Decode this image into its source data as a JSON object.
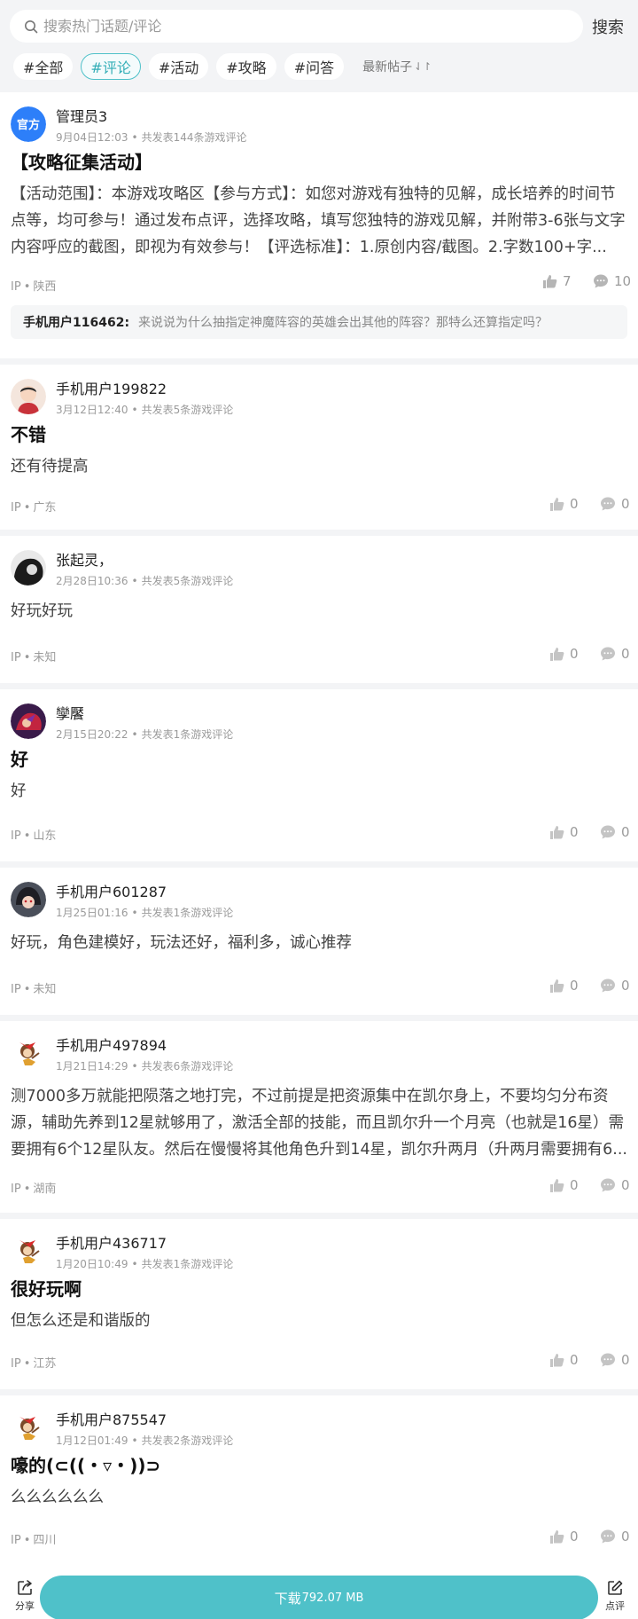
{
  "search": {
    "placeholder": "搜索热门话题/评论",
    "button": "搜索"
  },
  "filters": {
    "chips": [
      "#全部",
      "#评论",
      "#活动",
      "#攻略",
      "#问答"
    ],
    "active_index": 1,
    "sort_label": "最新帖子",
    "sort_icon": "sort-arrows-icon"
  },
  "colors": {
    "accent": "#4fc1c9",
    "official": "#2d7ff9"
  },
  "posts": [
    {
      "author": "管理员3",
      "avatar_badge": "官方",
      "time": "9月04日12:03",
      "count_text": "共发表144条游戏评论",
      "title": "【攻略征集活动】",
      "body": "【活动范围】：本游戏攻略区【参与方式】：如您对游戏有独特的见解，成长培养的时间节点等，均可参与！通过发布点评，选择攻略，填写您独特的游戏见解，并附带3-6张与文字内容呼应的截图，即视为有效参与！【评选标准】：1.原创内容/截图。2.字数100+字...",
      "ip_label": "IP",
      "ip": "陕西",
      "likes": "7",
      "comments": "10",
      "reply_user": "手机用户116462:",
      "reply_text": "来说说为什么抽指定神魔阵容的英雄会出其他的阵容？那特么还算指定吗？"
    },
    {
      "author": "手机用户199822",
      "time": "3月12日12:40",
      "count_text": "共发表5条游戏评论",
      "title": "不错",
      "body": "还有待提高",
      "ip_label": "IP",
      "ip": "广东",
      "likes": "0",
      "comments": "0"
    },
    {
      "author": "张起灵，",
      "time": "2月28日10:36",
      "count_text": "共发表5条游戏评论",
      "title": "",
      "body": "好玩好玩",
      "ip_label": "IP",
      "ip": "未知",
      "likes": "0",
      "comments": "0"
    },
    {
      "author": "孿饜",
      "time": "2月15日20:22",
      "count_text": "共发表1条游戏评论",
      "title": "好",
      "body": "好",
      "ip_label": "IP",
      "ip": "山东",
      "likes": "0",
      "comments": "0"
    },
    {
      "author": "手机用户601287",
      "time": "1月25日01:16",
      "count_text": "共发表1条游戏评论",
      "title": "",
      "body": "好玩，角色建模好，玩法还好，福利多，诚心推荐",
      "ip_label": "IP",
      "ip": "未知",
      "likes": "0",
      "comments": "0"
    },
    {
      "author": "手机用户497894",
      "time": "1月21日14:29",
      "count_text": "共发表6条游戏评论",
      "title": "",
      "body": "测7000多万就能把陨落之地打完，不过前提是把资源集中在凯尔身上，不要均匀分布资源，辅助先养到12星就够用了，激活全部的技能，而且凯尔升一个月亮（也就是16星）需要拥有6个12星队友。然后在慢慢将其他角色升到14星，凯尔升两月（升两月需要拥有6...",
      "ip_label": "IP",
      "ip": "湖南",
      "likes": "0",
      "comments": "0"
    },
    {
      "author": "手机用户436717",
      "time": "1月20日10:49",
      "count_text": "共发表1条游戏评论",
      "title": "很好玩啊",
      "body": "但怎么还是和谐版的",
      "ip_label": "IP",
      "ip": "江苏",
      "likes": "0",
      "comments": "0"
    },
    {
      "author": "手机用户875547",
      "time": "1月12日01:49",
      "count_text": "共发表2条游戏评论",
      "title": "嚎的(⊂((・▿・))⊃",
      "body": "么么么么么么",
      "ip_label": "IP",
      "ip": "四川",
      "likes": "0",
      "comments": "0"
    }
  ],
  "bottom": {
    "share_label": "分享",
    "download_label": "下载",
    "download_size": "792.07 MB",
    "review_label": "点评"
  }
}
